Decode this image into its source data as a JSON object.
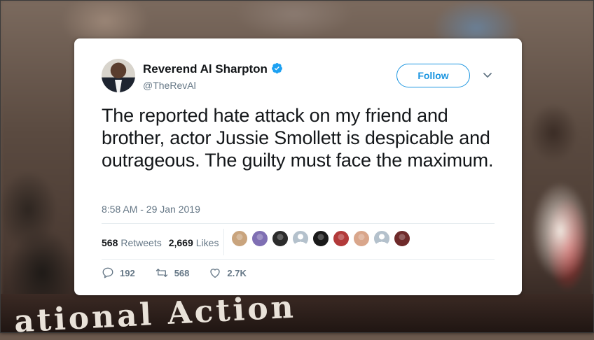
{
  "tweet": {
    "author_name": "Reverend Al Sharpton",
    "handle": "@TheRevAl",
    "follow_label": "Follow",
    "text": "The reported hate attack on my friend and brother, actor Jussie Smollett is despicable and outrageous. The guilty must face the maximum.",
    "timestamp": "8:58 AM - 29 Jan 2019",
    "retweets_count": "568",
    "retweets_label": "Retweets",
    "likes_count": "2,669",
    "likes_label": "Likes",
    "reply_count": "192",
    "retweet_action_count": "568",
    "like_action_count": "2.7K"
  },
  "likers": [
    {
      "icon": "user-avatar",
      "color": "#c9a47d"
    },
    {
      "icon": "user-avatar",
      "color": "#7f6fb3"
    },
    {
      "icon": "user-avatar",
      "color": "#2c2c2c"
    },
    {
      "icon": "default-avatar",
      "color": "#b4c1cc"
    },
    {
      "icon": "user-avatar",
      "color": "#1a1a1a"
    },
    {
      "icon": "user-avatar",
      "color": "#b23a3a"
    },
    {
      "icon": "user-avatar",
      "color": "#d9a68b"
    },
    {
      "icon": "default-avatar",
      "color": "#b4c1cc"
    },
    {
      "icon": "user-avatar",
      "color": "#6e2a2a"
    }
  ],
  "background": {
    "banner_text": "ational Action"
  },
  "colors": {
    "accent": "#1b95e0",
    "text_primary": "#14171a",
    "text_secondary": "#657786",
    "verified": "#1da1f2"
  }
}
